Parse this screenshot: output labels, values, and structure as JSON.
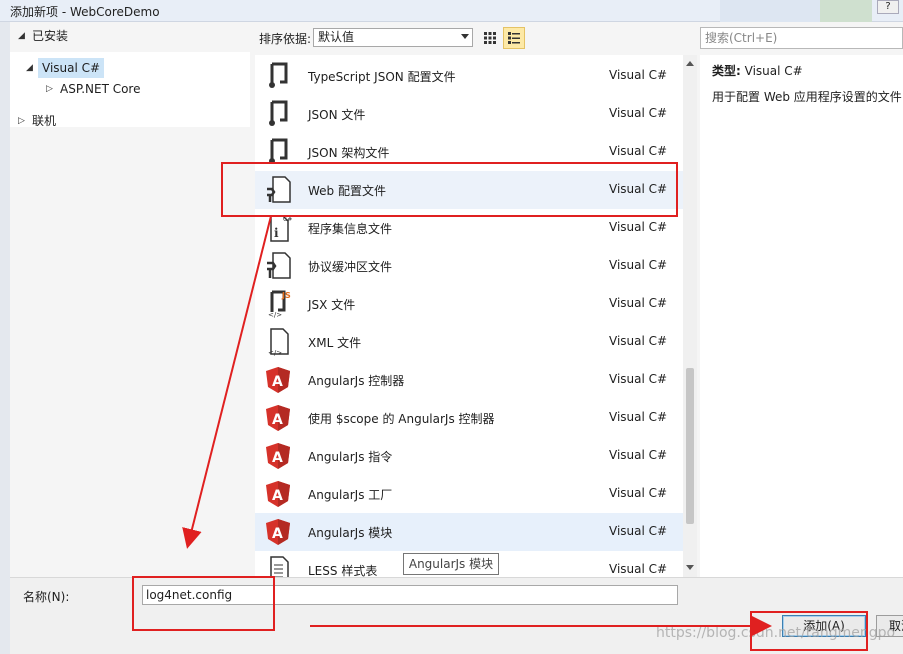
{
  "window": {
    "title": "添加新项 - WebCoreDemo"
  },
  "tree": {
    "installed_label": "已安装",
    "items": [
      {
        "label": "Visual C#"
      },
      {
        "label": "ASP.NET Core"
      }
    ],
    "online_label": "联机"
  },
  "toolbar": {
    "sort_label": "排序依据:",
    "sort_value": "默认值"
  },
  "search": {
    "placeholder": "搜索(Ctrl+E)"
  },
  "items": [
    {
      "name": "TypeScript JSON 配置文件",
      "type": "Visual C#",
      "icon": "json-config-icon"
    },
    {
      "name": "JSON 文件",
      "type": "Visual C#",
      "icon": "json-file-icon"
    },
    {
      "name": "JSON 架构文件",
      "type": "Visual C#",
      "icon": "json-schema-icon"
    },
    {
      "name": "Web 配置文件",
      "type": "Visual C#",
      "icon": "web-config-icon"
    },
    {
      "name": "程序集信息文件",
      "type": "Visual C#",
      "icon": "assembly-info-icon"
    },
    {
      "name": "协议缓冲区文件",
      "type": "Visual C#",
      "icon": "protobuf-file-icon"
    },
    {
      "name": "JSX 文件",
      "type": "Visual C#",
      "icon": "jsx-file-icon"
    },
    {
      "name": "XML 文件",
      "type": "Visual C#",
      "icon": "xml-file-icon"
    },
    {
      "name": "AngularJs 控制器",
      "type": "Visual C#",
      "icon": "angular-icon"
    },
    {
      "name": "使用 $scope 的 AngularJs 控制器",
      "type": "Visual C#",
      "icon": "angular-icon"
    },
    {
      "name": "AngularJs 指令",
      "type": "Visual C#",
      "icon": "angular-icon"
    },
    {
      "name": "AngularJs 工厂",
      "type": "Visual C#",
      "icon": "angular-icon"
    },
    {
      "name": "AngularJs 模块",
      "type": "Visual C#",
      "icon": "angular-icon"
    },
    {
      "name": "LESS 样式表",
      "type": "Visual C#",
      "icon": "less-file-icon"
    }
  ],
  "details": {
    "type_label": "类型:",
    "type_value": "Visual C#",
    "description": "用于配置 Web 应用程序设置的文件"
  },
  "tooltip": {
    "text": "AngularJs 模块"
  },
  "bottom": {
    "name_label": "名称(N):",
    "name_value": "log4net.config",
    "add_label": "添加(A)",
    "cancel_label": "取消"
  },
  "watermark": "https://blog.csdn.net/tangmengpo",
  "colors": {
    "annotation": "#e02020",
    "selection": "#cce4f7",
    "accent": "#3c7fb1"
  }
}
